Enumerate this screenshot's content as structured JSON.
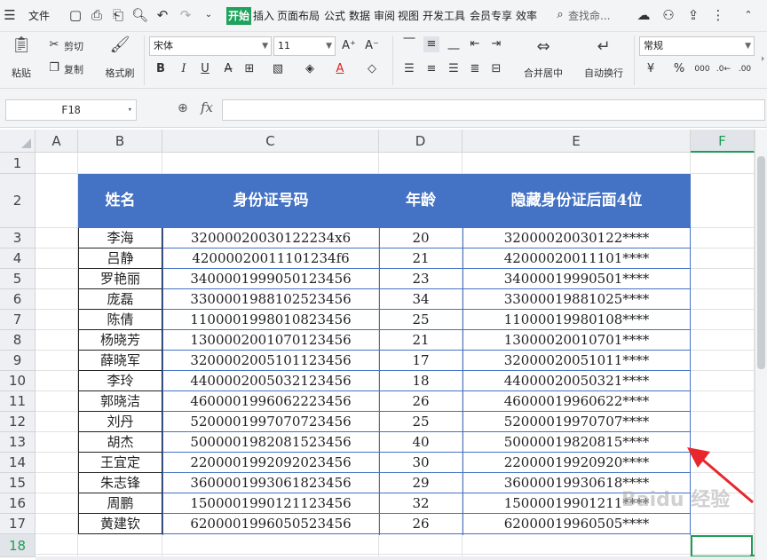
{
  "menubar": {
    "file_label": "文件",
    "tabs": [
      "开始",
      "插入",
      "页面布局",
      "公式",
      "数据",
      "审阅",
      "视图",
      "开发工具",
      "会员专享",
      "效率"
    ],
    "search_label": "查找命..."
  },
  "ribbon": {
    "paste": "粘贴",
    "cut": "剪切",
    "copy": "复制",
    "format_painter": "格式刷",
    "font_name": "宋体",
    "font_size": "11",
    "merge_center": "合并居中",
    "wrap_text": "自动换行",
    "number_format": "常规",
    "currency": "¥",
    "percent": "%"
  },
  "formula_bar": {
    "name_box": "F18",
    "fx": "fx",
    "value": ""
  },
  "sheet": {
    "columns": [
      "A",
      "B",
      "C",
      "D",
      "E",
      "F"
    ],
    "selected_column": "F",
    "rows": [
      "1",
      "2",
      "3",
      "4",
      "5",
      "6",
      "7",
      "8",
      "9",
      "10",
      "11",
      "12",
      "13",
      "14",
      "15",
      "16",
      "17",
      "18"
    ],
    "selected_row": "18",
    "headers": [
      "姓名",
      "身份证号码",
      "年龄",
      "隐藏身份证后面4位"
    ],
    "data": [
      [
        "李海",
        "32000020030122234x6",
        "20",
        "32000020030122****"
      ],
      [
        "吕静",
        "42000020011101234f6",
        "21",
        "42000020011101****"
      ],
      [
        "罗艳丽",
        "340000199905012345 6",
        "23",
        "34000019990501****"
      ],
      [
        "庞磊",
        "330000198810252345 6",
        "34",
        "33000019881025****"
      ],
      [
        "陈倩",
        "110000199801082345 6",
        "25",
        "11000019980108****"
      ],
      [
        "杨晓芳",
        "130000200107012345 6",
        "21",
        "13000020010701****"
      ],
      [
        "薛晓军",
        "320000200510112345 6",
        "17",
        "32000020051011****"
      ],
      [
        "李玲",
        "440000200503212345 6",
        "18",
        "44000020050321****"
      ],
      [
        "郭晓洁",
        "460000199606222345 6",
        "26",
        "46000019960622****"
      ],
      [
        "刘丹",
        "520000199707072345 6",
        "25",
        "52000019970707****"
      ],
      [
        "胡杰",
        "500000198208152345 6",
        "40",
        "50000019820815****"
      ],
      [
        "王宜定",
        "220000199209202345 6",
        "30",
        "22000019920920****"
      ],
      [
        "朱志锋",
        "360000199306182345 6",
        "29",
        "36000019930618****"
      ],
      [
        "周鹏",
        "150000199012112345 6",
        "32",
        "15000019901211****"
      ],
      [
        "黄建钦",
        "620000199605052345 6",
        "26",
        "62000019960505****"
      ]
    ]
  },
  "watermark": "Baidu 经验",
  "colors": {
    "accent": "#1f9c56",
    "header_fill": "#4472c4",
    "arrow": "#e8262c"
  }
}
